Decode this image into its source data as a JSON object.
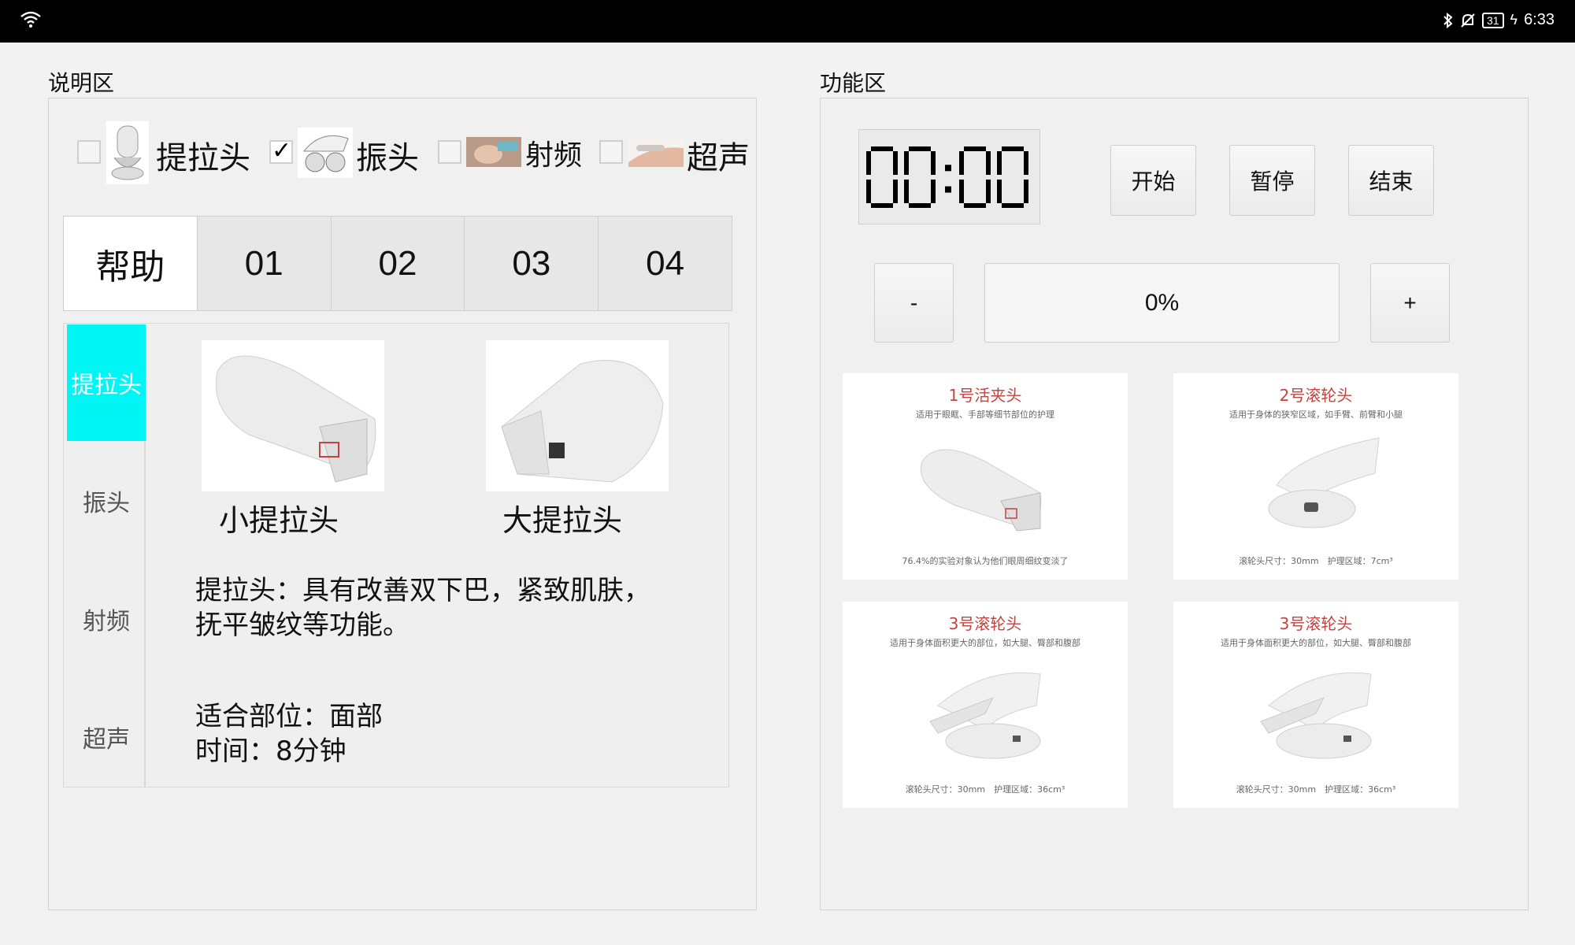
{
  "status_bar": {
    "time": "6:33",
    "battery": "31",
    "icons": [
      "wifi-icon",
      "bluetooth-icon",
      "silent-bell-icon",
      "battery-icon",
      "charging-icon"
    ]
  },
  "left": {
    "title": "说明区",
    "checkboxes": [
      {
        "label": "提拉头",
        "checked": false
      },
      {
        "label": "振头",
        "checked": true
      },
      {
        "label": "射频",
        "checked": false
      },
      {
        "label": "超声",
        "checked": false
      }
    ],
    "tabs": [
      "帮助",
      "01",
      "02",
      "03",
      "04"
    ],
    "active_tab": "帮助",
    "side_nav": [
      "提拉头",
      "振头",
      "射频",
      "超声"
    ],
    "active_side": "提拉头",
    "products": [
      {
        "label": "小提拉头"
      },
      {
        "label": "大提拉头"
      }
    ],
    "description": [
      "提拉头：具有改善双下巴，紧致肌肤，",
      "抚平皱纹等功能。"
    ],
    "details": [
      "适合部位：面部",
      "时间：8分钟"
    ]
  },
  "right": {
    "title": "功能区",
    "timer": "00:00",
    "buttons": {
      "start": "开始",
      "pause": "暂停",
      "stop": "结束"
    },
    "intensity": {
      "minus": "-",
      "value": "0%",
      "plus": "+"
    },
    "cards": [
      {
        "title": "1号活夹头",
        "subtitle": "适用于眼眶、手部等细节部位的护理",
        "footer": "76.4%的实验对象认为他们眼周细纹变淡了"
      },
      {
        "title": "2号滚轮头",
        "subtitle": "适用于身体的狭窄区域，如手臂、前臂和小腿",
        "footer": "滚轮头尺寸：30mm　护理区域：7cm³"
      },
      {
        "title": "3号滚轮头",
        "subtitle": "适用于身体面积更大的部位，如大腿、臀部和腹部",
        "footer": "滚轮头尺寸：30mm　护理区域：36cm³"
      },
      {
        "title": "3号滚轮头",
        "subtitle": "适用于身体面积更大的部位，如大腿、臀部和腹部",
        "footer": "滚轮头尺寸：30mm　护理区域：36cm³"
      }
    ]
  },
  "colors": {
    "active_side": "#00f5f5",
    "card_title": "#c6423d",
    "status_bar": "#000000"
  }
}
